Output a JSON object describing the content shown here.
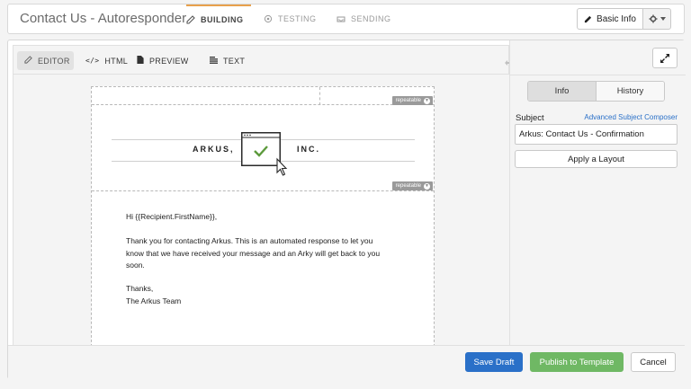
{
  "header": {
    "title": "Contact Us - Autoresponder",
    "tabs": [
      {
        "label": "BUILDING",
        "icon": "edit-icon"
      },
      {
        "label": "TESTING",
        "icon": "target-icon"
      },
      {
        "label": "SENDING",
        "icon": "inbox-icon"
      }
    ],
    "basic_info_label": "Basic Info"
  },
  "editor_toolbar": {
    "buttons": [
      {
        "label": "EDITOR",
        "icon": "edit-icon"
      },
      {
        "label": "HTML",
        "icon": "code-icon"
      },
      {
        "label": "PREVIEW",
        "icon": "document-icon"
      },
      {
        "label": "TEXT",
        "icon": "text-lines-icon"
      }
    ]
  },
  "email": {
    "repeatable_label": "repeatable",
    "logo_left": "ARKUS,",
    "logo_right": "INC.",
    "greeting": "Hi {{Recipient.FirstName}},",
    "paragraph_lines": [
      "Thank you for contacting Arkus. This is an automated response to let you",
      "know that we have received your message and an Arky will get back to you",
      "soon."
    ],
    "signoff": "Thanks,",
    "signature": "The Arkus Team"
  },
  "side_panel": {
    "tabs": [
      "Info",
      "History"
    ],
    "subject_label": "Subject",
    "advanced_link": "Advanced Subject Composer",
    "subject_value": "Arkus: Contact Us - Confirmation",
    "apply_layout_label": "Apply a Layout"
  },
  "footer": {
    "save_draft": "Save Draft",
    "publish": "Publish to Template",
    "cancel": "Cancel"
  },
  "colors": {
    "active_tab_accent": "#e8a04c",
    "primary_button": "#2a70c8",
    "success_button": "#6fb864",
    "link": "#2a70c8",
    "checkmark": "#5c9a3c"
  }
}
